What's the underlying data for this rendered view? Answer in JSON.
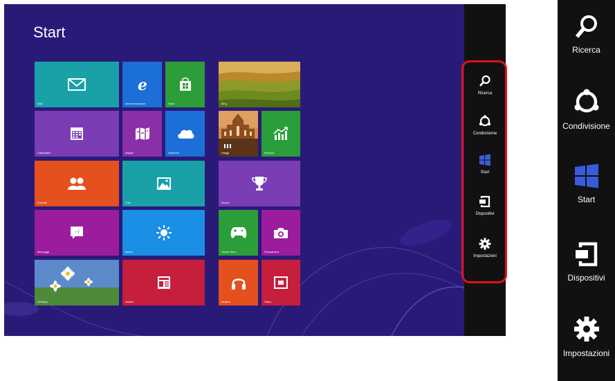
{
  "start_screen": {
    "title": "Start",
    "tiles": [
      {
        "name": "Mail",
        "color": "#1aa1a8",
        "icon": "mail-icon"
      },
      {
        "name": "Internet Explorer",
        "color": "#1b6fd6",
        "icon": "internet-explorer-icon"
      },
      {
        "name": "Store",
        "color": "#2b9e3a",
        "icon": "store-icon"
      },
      {
        "name": "Calendario",
        "color": "#7b3db3",
        "icon": "calendar-icon"
      },
      {
        "name": "Mappe",
        "color": "#8a2fa8",
        "icon": "maps-icon"
      },
      {
        "name": "SkyDrive",
        "color": "#1b6fd6",
        "icon": "cloud-icon"
      },
      {
        "name": "Contatti",
        "color": "#e4501e",
        "icon": "people-icon"
      },
      {
        "name": "Foto",
        "color": "#1aa1a8",
        "icon": "photo-icon"
      },
      {
        "name": "Messaggi",
        "color": "#9b1d9e",
        "icon": "messaging-icon"
      },
      {
        "name": "Meteo",
        "color": "#1b8fe6",
        "icon": "sun-icon"
      },
      {
        "name": "Desktop",
        "color": "#5c8acb",
        "icon": "desktop-icon"
      },
      {
        "name": "Notizie",
        "color": "#c51f3d",
        "icon": "news-icon"
      },
      {
        "name": "Bing",
        "color": "#c7a13a",
        "icon": "landscape-icon"
      },
      {
        "name": "Viaggi",
        "color": "#a06a3a",
        "icon": "travel-icon"
      },
      {
        "name": "Finanza",
        "color": "#2b9e3a",
        "icon": "finance-icon"
      },
      {
        "name": "Giochi",
        "color": "#7b3db3",
        "icon": "trophy-icon"
      },
      {
        "name": "Giochi Xbox",
        "color": "#2b9e3a",
        "icon": "xbox-icon"
      },
      {
        "name": "Fotocamera",
        "color": "#9b1d9e",
        "icon": "camera-icon"
      },
      {
        "name": "Musica",
        "color": "#e4501e",
        "icon": "headphones-icon"
      },
      {
        "name": "Video",
        "color": "#c51f3d",
        "icon": "video-icon"
      }
    ]
  },
  "charms": [
    {
      "label": "Ricerca",
      "icon": "search-icon"
    },
    {
      "label": "Condivisione",
      "icon": "share-icon"
    },
    {
      "label": "Start",
      "icon": "windows-icon"
    },
    {
      "label": "Dispositivi",
      "icon": "devices-icon"
    },
    {
      "label": "Impostazioni",
      "icon": "gear-icon"
    }
  ],
  "colors": {
    "background": "#2a1a78",
    "charms_bar": "#111111",
    "highlight": "#e0101e"
  }
}
